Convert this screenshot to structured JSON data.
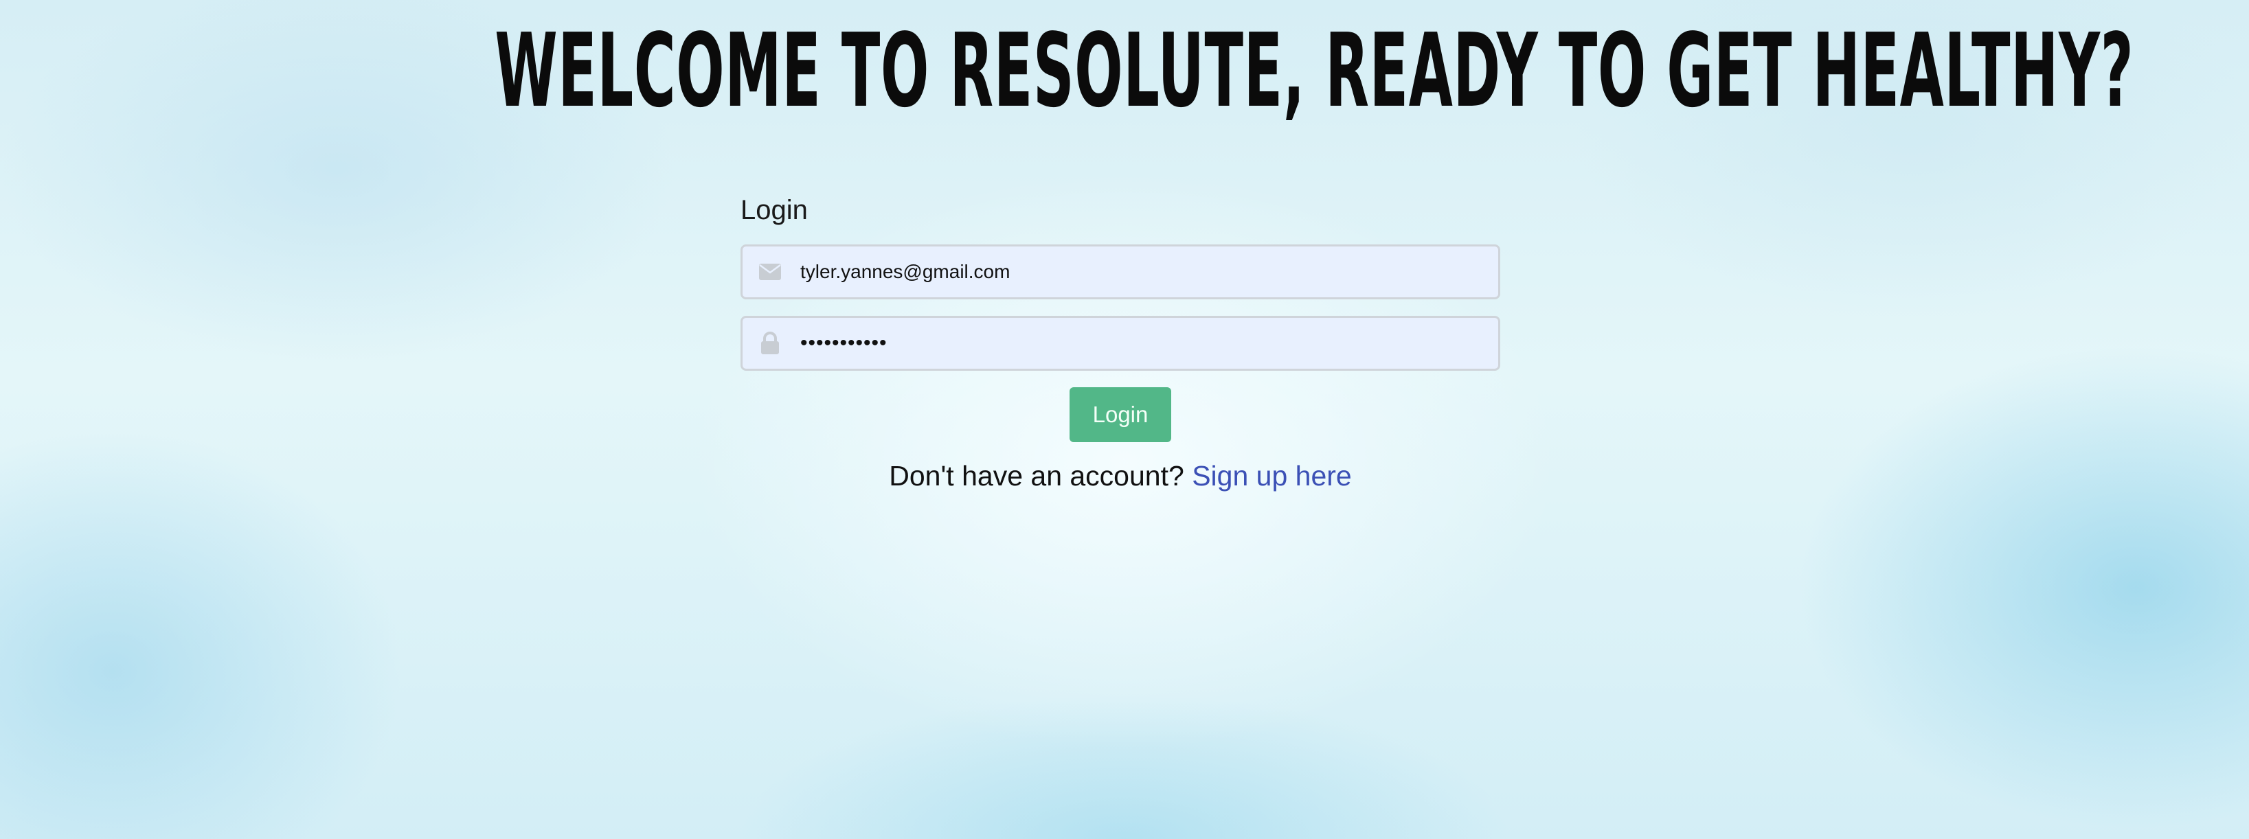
{
  "header": {
    "headline": "WELCOME TO RESOLUTE, READY TO GET HEALTHY?"
  },
  "login_form": {
    "label": "Login",
    "email": {
      "value": "tyler.yannes@gmail.com",
      "icon": "envelope-icon"
    },
    "password": {
      "value": "•••••••••••",
      "icon": "lock-icon"
    },
    "submit_label": "Login",
    "signup_prompt": "Don't have an account?",
    "signup_link": "Sign up here"
  },
  "colors": {
    "button": "#52b788",
    "link": "#3b50b5",
    "field_bg": "#e8f0fe",
    "icon": "#c8cdd3"
  }
}
